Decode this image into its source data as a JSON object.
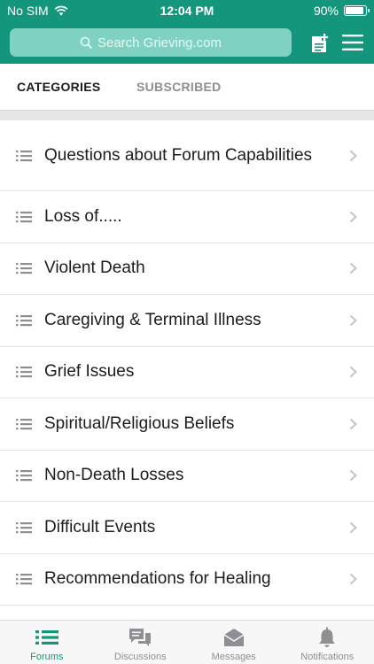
{
  "status_bar": {
    "carrier": "No SIM",
    "time": "12:04 PM",
    "battery_label": "90%",
    "battery_level": 0.9
  },
  "header": {
    "search_placeholder": "Search Grieving.com",
    "accent_color": "#14967d",
    "search_bg_color": "#7fd1c2",
    "icons": [
      "search-icon",
      "new-post-icon",
      "hamburger-menu-icon"
    ]
  },
  "tabs": [
    {
      "label": "CATEGORIES",
      "active": true
    },
    {
      "label": "SUBSCRIBED",
      "active": false
    }
  ],
  "categories": [
    {
      "label": "Questions about Forum Capabilities"
    },
    {
      "label": "Loss of....."
    },
    {
      "label": "Violent Death"
    },
    {
      "label": "Caregiving & Terminal Illness"
    },
    {
      "label": "Grief Issues"
    },
    {
      "label": "Spiritual/Religious Beliefs"
    },
    {
      "label": "Non-Death Losses"
    },
    {
      "label": "Difficult Events"
    },
    {
      "label": "Recommendations for Healing"
    }
  ],
  "bottom_nav": [
    {
      "label": "Forums",
      "icon": "forums-list-icon",
      "active": true
    },
    {
      "label": "Discussions",
      "icon": "chat-bubbles-icon",
      "active": false
    },
    {
      "label": "Messages",
      "icon": "envelope-icon",
      "active": false
    },
    {
      "label": "Notifications",
      "icon": "bell-icon",
      "active": false
    }
  ]
}
